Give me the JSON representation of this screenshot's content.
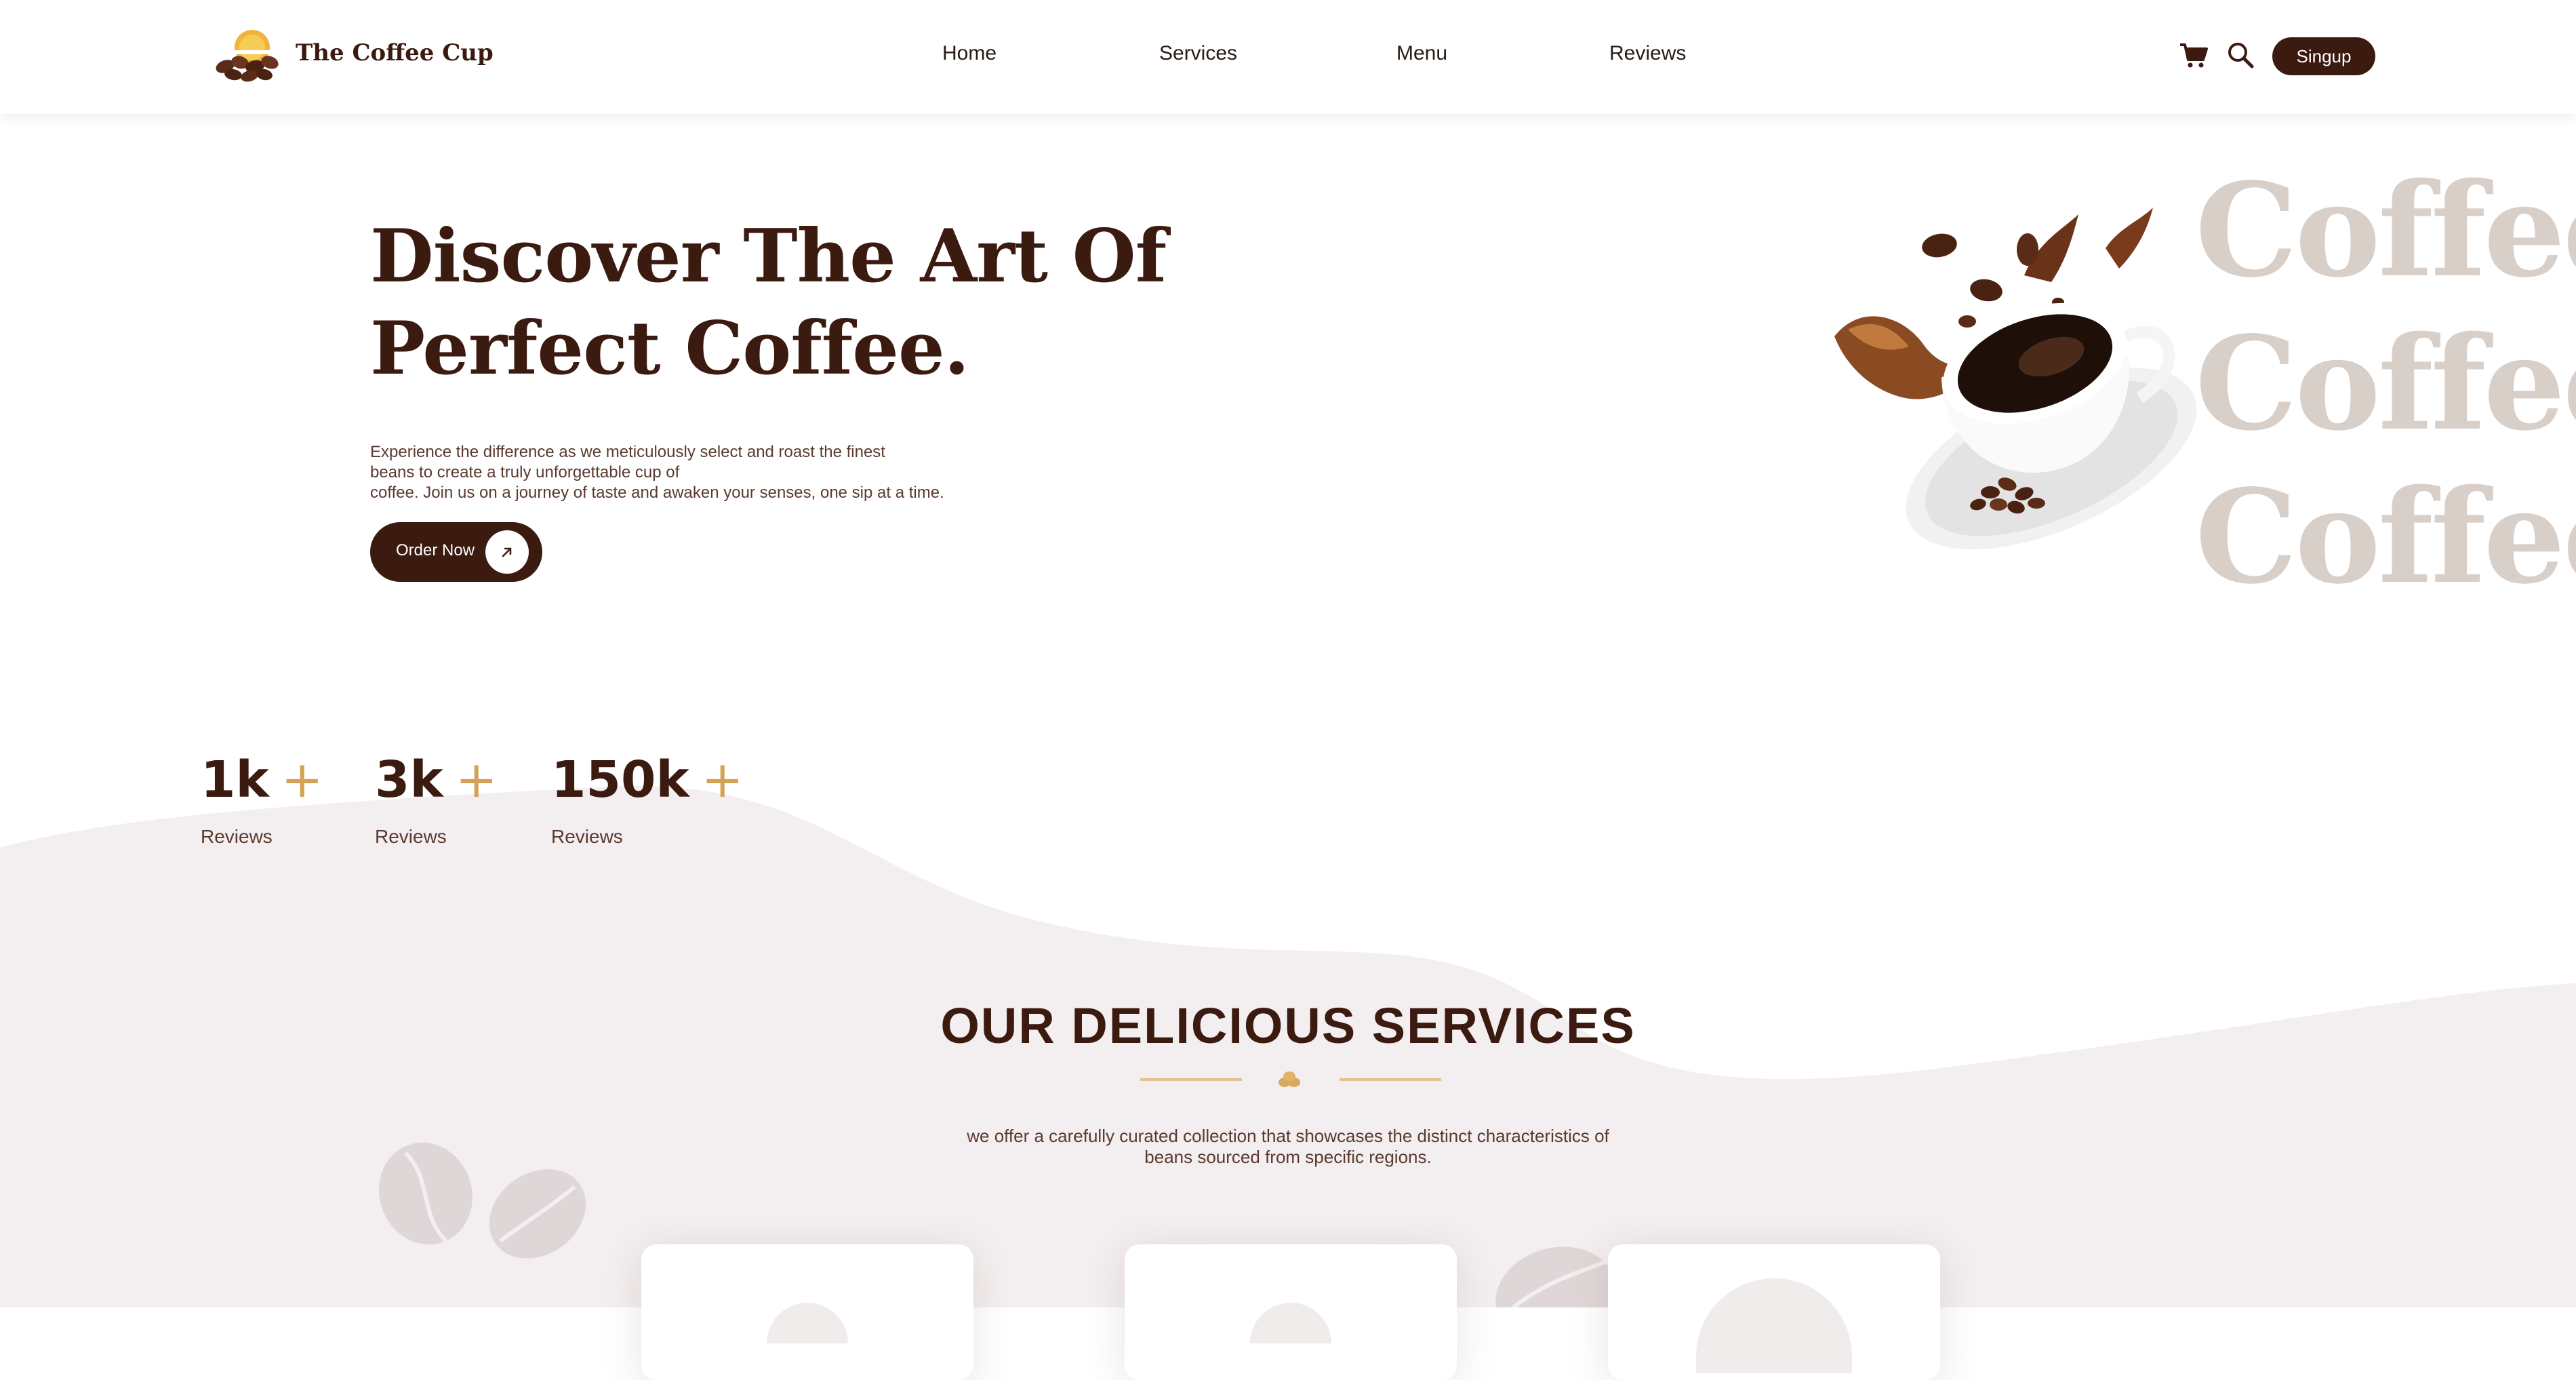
{
  "header": {
    "logo_text": "The Coffee Cup",
    "nav": [
      "Home",
      "Services",
      "Menu",
      "Reviews"
    ],
    "signup_label": "Singup",
    "icons": [
      "cart-icon",
      "search-icon"
    ]
  },
  "hero": {
    "title_line1": "Discover The Art Of",
    "title_line2": "Perfect Coffee.",
    "description_line1": "Experience the difference as we meticulously select and roast the finest",
    "description_line2": "beans to create a truly unforgettable cup of",
    "description_line3": "coffee. Join us on a journey of taste and awaken your senses, one sip at a time.",
    "order_button_label": "Order Now",
    "background_words": [
      "Coffee",
      "Coffee",
      "Coffee"
    ]
  },
  "stats": [
    {
      "value": "1k",
      "suffix": "+",
      "label": "Reviews"
    },
    {
      "value": "3k",
      "suffix": "+",
      "label": "Reviews"
    },
    {
      "value": "150k",
      "suffix": "+",
      "label": "Reviews"
    }
  ],
  "services": {
    "title": "OUR DELICIOUS SERVICES",
    "description_line1": "we offer a carefully curated collection that showcases the distinct characteristics of",
    "description_line2": "beans sourced from specific regions."
  },
  "colors": {
    "brand_dark": "#3b1a10",
    "accent_gold": "#d3a257",
    "soft_background": "#f3eeef",
    "watermark_text": "#d9cfc9"
  }
}
